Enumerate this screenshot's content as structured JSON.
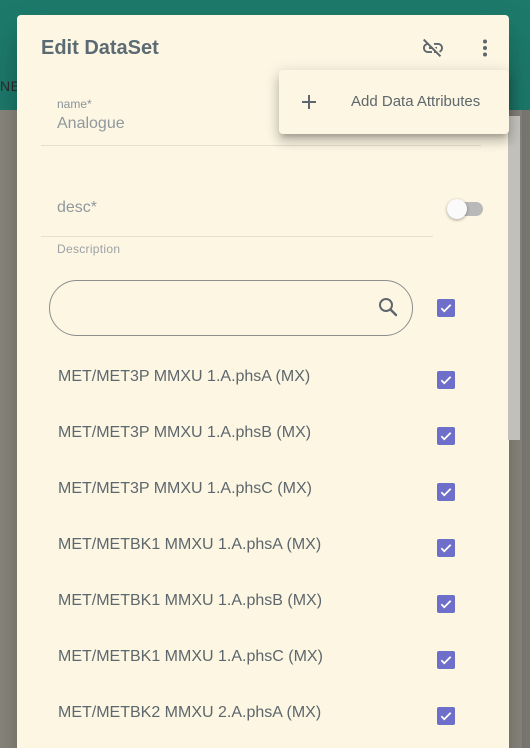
{
  "background": {
    "app_bar_fragment": "NE"
  },
  "dialog": {
    "title": "Edit DataSet",
    "name_field": {
      "label": "name*",
      "value": "Analogue"
    },
    "desc_field": {
      "placeholder": "desc*",
      "helper": "Description",
      "toggle_on": false
    },
    "search": {
      "value": "",
      "select_all_checked": true
    },
    "items": [
      {
        "label": "MET/MET3P MMXU 1.A.phsA (MX)",
        "checked": true
      },
      {
        "label": "MET/MET3P MMXU 1.A.phsB (MX)",
        "checked": true
      },
      {
        "label": "MET/MET3P MMXU 1.A.phsC (MX)",
        "checked": true
      },
      {
        "label": "MET/METBK1 MMXU 1.A.phsA (MX)",
        "checked": true
      },
      {
        "label": "MET/METBK1 MMXU 1.A.phsB (MX)",
        "checked": true
      },
      {
        "label": "MET/METBK1 MMXU 1.A.phsC (MX)",
        "checked": true
      },
      {
        "label": "MET/METBK2 MMXU 2.A.phsA (MX)",
        "checked": true
      }
    ]
  },
  "menu": {
    "items": [
      {
        "icon": "plus-icon",
        "label": "Add Data Attributes"
      }
    ]
  },
  "colors": {
    "app_bar": "#1d7a6b",
    "dialog_bg": "#fdf6e3",
    "checkbox": "#6e6fc9",
    "title_text": "#5c6b73"
  }
}
